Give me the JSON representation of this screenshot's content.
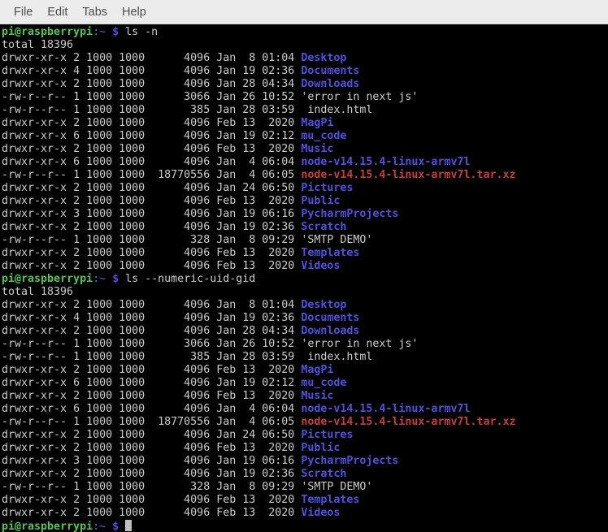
{
  "window": {
    "title": "pi@raspberrypi: ~",
    "background": "#000000",
    "foreground": "#cccccc"
  },
  "menubar": {
    "items": [
      {
        "label": "File",
        "name": "menu-file"
      },
      {
        "label": "Edit",
        "name": "menu-edit"
      },
      {
        "label": "Tabs",
        "name": "menu-tabs"
      },
      {
        "label": "Help",
        "name": "menu-help"
      }
    ]
  },
  "colors": {
    "prompt_user_host": "#4ec94e",
    "prompt_path": "#6565e0",
    "prompt_dollar": "#4e4ee8",
    "directory": "#5050e6",
    "archive": "#cc3b3b",
    "regular_file": "#cccccc",
    "menubar_bg": "#ececec",
    "terminal_bg": "#000000"
  },
  "prompt": {
    "user_host": "pi@raspberrypi",
    "path": ":~",
    "dollar": "$"
  },
  "session": {
    "blocks": [
      {
        "command": "ls -n",
        "total_line": "total 18396",
        "rows": [
          {
            "perms": "drwxr-xr-x",
            "links": "2",
            "uid": "1000",
            "gid": "1000",
            "size": "4096",
            "month": "Jan",
            "day": " 8",
            "time": "01:04",
            "name": "Desktop",
            "type": "dir"
          },
          {
            "perms": "drwxr-xr-x",
            "links": "4",
            "uid": "1000",
            "gid": "1000",
            "size": "4096",
            "month": "Jan",
            "day": "19",
            "time": "02:36",
            "name": "Documents",
            "type": "dir"
          },
          {
            "perms": "drwxr-xr-x",
            "links": "2",
            "uid": "1000",
            "gid": "1000",
            "size": "4096",
            "month": "Jan",
            "day": "28",
            "time": "04:34",
            "name": "Downloads",
            "type": "dir"
          },
          {
            "perms": "-rw-r--r--",
            "links": "1",
            "uid": "1000",
            "gid": "1000",
            "size": "3066",
            "month": "Jan",
            "day": "26",
            "time": "10:52",
            "name": "'error in next js'",
            "type": "file"
          },
          {
            "perms": "-rw-r--r--",
            "links": "1",
            "uid": "1000",
            "gid": "1000",
            "size": "385",
            "month": "Jan",
            "day": "28",
            "time": "03:59",
            "name": " index.html",
            "type": "file"
          },
          {
            "perms": "drwxr-xr-x",
            "links": "2",
            "uid": "1000",
            "gid": "1000",
            "size": "4096",
            "month": "Feb",
            "day": "13",
            "time": " 2020",
            "name": "MagPi",
            "type": "dir"
          },
          {
            "perms": "drwxr-xr-x",
            "links": "6",
            "uid": "1000",
            "gid": "1000",
            "size": "4096",
            "month": "Jan",
            "day": "19",
            "time": "02:12",
            "name": "mu_code",
            "type": "dir"
          },
          {
            "perms": "drwxr-xr-x",
            "links": "2",
            "uid": "1000",
            "gid": "1000",
            "size": "4096",
            "month": "Feb",
            "day": "13",
            "time": " 2020",
            "name": "Music",
            "type": "dir"
          },
          {
            "perms": "drwxr-xr-x",
            "links": "6",
            "uid": "1000",
            "gid": "1000",
            "size": "4096",
            "month": "Jan",
            "day": " 4",
            "time": "06:04",
            "name": "node-v14.15.4-linux-armv7l",
            "type": "dir"
          },
          {
            "perms": "-rw-r--r--",
            "links": "1",
            "uid": "1000",
            "gid": "1000",
            "size": "18770556",
            "month": "Jan",
            "day": " 4",
            "time": "06:05",
            "name": "node-v14.15.4-linux-armv7l.tar.xz",
            "type": "archive"
          },
          {
            "perms": "drwxr-xr-x",
            "links": "2",
            "uid": "1000",
            "gid": "1000",
            "size": "4096",
            "month": "Jan",
            "day": "24",
            "time": "06:50",
            "name": "Pictures",
            "type": "dir"
          },
          {
            "perms": "drwxr-xr-x",
            "links": "2",
            "uid": "1000",
            "gid": "1000",
            "size": "4096",
            "month": "Feb",
            "day": "13",
            "time": " 2020",
            "name": "Public",
            "type": "dir"
          },
          {
            "perms": "drwxr-xr-x",
            "links": "3",
            "uid": "1000",
            "gid": "1000",
            "size": "4096",
            "month": "Jan",
            "day": "19",
            "time": "06:16",
            "name": "PycharmProjects",
            "type": "dir"
          },
          {
            "perms": "drwxr-xr-x",
            "links": "2",
            "uid": "1000",
            "gid": "1000",
            "size": "4096",
            "month": "Jan",
            "day": "19",
            "time": "02:36",
            "name": "Scratch",
            "type": "dir"
          },
          {
            "perms": "-rw-r--r--",
            "links": "1",
            "uid": "1000",
            "gid": "1000",
            "size": "328",
            "month": "Jan",
            "day": " 8",
            "time": "09:29",
            "name": "'SMTP DEMO'",
            "type": "file"
          },
          {
            "perms": "drwxr-xr-x",
            "links": "2",
            "uid": "1000",
            "gid": "1000",
            "size": "4096",
            "month": "Feb",
            "day": "13",
            "time": " 2020",
            "name": "Templates",
            "type": "dir"
          },
          {
            "perms": "drwxr-xr-x",
            "links": "2",
            "uid": "1000",
            "gid": "1000",
            "size": "4096",
            "month": "Feb",
            "day": "13",
            "time": " 2020",
            "name": "Videos",
            "type": "dir"
          }
        ]
      },
      {
        "command": "ls --numeric-uid-gid",
        "total_line": "total 18396",
        "rows": [
          {
            "perms": "drwxr-xr-x",
            "links": "2",
            "uid": "1000",
            "gid": "1000",
            "size": "4096",
            "month": "Jan",
            "day": " 8",
            "time": "01:04",
            "name": "Desktop",
            "type": "dir"
          },
          {
            "perms": "drwxr-xr-x",
            "links": "4",
            "uid": "1000",
            "gid": "1000",
            "size": "4096",
            "month": "Jan",
            "day": "19",
            "time": "02:36",
            "name": "Documents",
            "type": "dir"
          },
          {
            "perms": "drwxr-xr-x",
            "links": "2",
            "uid": "1000",
            "gid": "1000",
            "size": "4096",
            "month": "Jan",
            "day": "28",
            "time": "04:34",
            "name": "Downloads",
            "type": "dir"
          },
          {
            "perms": "-rw-r--r--",
            "links": "1",
            "uid": "1000",
            "gid": "1000",
            "size": "3066",
            "month": "Jan",
            "day": "26",
            "time": "10:52",
            "name": "'error in next js'",
            "type": "file"
          },
          {
            "perms": "-rw-r--r--",
            "links": "1",
            "uid": "1000",
            "gid": "1000",
            "size": "385",
            "month": "Jan",
            "day": "28",
            "time": "03:59",
            "name": " index.html",
            "type": "file"
          },
          {
            "perms": "drwxr-xr-x",
            "links": "2",
            "uid": "1000",
            "gid": "1000",
            "size": "4096",
            "month": "Feb",
            "day": "13",
            "time": " 2020",
            "name": "MagPi",
            "type": "dir"
          },
          {
            "perms": "drwxr-xr-x",
            "links": "6",
            "uid": "1000",
            "gid": "1000",
            "size": "4096",
            "month": "Jan",
            "day": "19",
            "time": "02:12",
            "name": "mu_code",
            "type": "dir"
          },
          {
            "perms": "drwxr-xr-x",
            "links": "2",
            "uid": "1000",
            "gid": "1000",
            "size": "4096",
            "month": "Feb",
            "day": "13",
            "time": " 2020",
            "name": "Music",
            "type": "dir"
          },
          {
            "perms": "drwxr-xr-x",
            "links": "6",
            "uid": "1000",
            "gid": "1000",
            "size": "4096",
            "month": "Jan",
            "day": " 4",
            "time": "06:04",
            "name": "node-v14.15.4-linux-armv7l",
            "type": "dir"
          },
          {
            "perms": "-rw-r--r--",
            "links": "1",
            "uid": "1000",
            "gid": "1000",
            "size": "18770556",
            "month": "Jan",
            "day": " 4",
            "time": "06:05",
            "name": "node-v14.15.4-linux-armv7l.tar.xz",
            "type": "archive"
          },
          {
            "perms": "drwxr-xr-x",
            "links": "2",
            "uid": "1000",
            "gid": "1000",
            "size": "4096",
            "month": "Jan",
            "day": "24",
            "time": "06:50",
            "name": "Pictures",
            "type": "dir"
          },
          {
            "perms": "drwxr-xr-x",
            "links": "2",
            "uid": "1000",
            "gid": "1000",
            "size": "4096",
            "month": "Feb",
            "day": "13",
            "time": " 2020",
            "name": "Public",
            "type": "dir"
          },
          {
            "perms": "drwxr-xr-x",
            "links": "3",
            "uid": "1000",
            "gid": "1000",
            "size": "4096",
            "month": "Jan",
            "day": "19",
            "time": "06:16",
            "name": "PycharmProjects",
            "type": "dir"
          },
          {
            "perms": "drwxr-xr-x",
            "links": "2",
            "uid": "1000",
            "gid": "1000",
            "size": "4096",
            "month": "Jan",
            "day": "19",
            "time": "02:36",
            "name": "Scratch",
            "type": "dir"
          },
          {
            "perms": "-rw-r--r--",
            "links": "1",
            "uid": "1000",
            "gid": "1000",
            "size": "328",
            "month": "Jan",
            "day": " 8",
            "time": "09:29",
            "name": "'SMTP DEMO'",
            "type": "file"
          },
          {
            "perms": "drwxr-xr-x",
            "links": "2",
            "uid": "1000",
            "gid": "1000",
            "size": "4096",
            "month": "Feb",
            "day": "13",
            "time": " 2020",
            "name": "Templates",
            "type": "dir"
          },
          {
            "perms": "drwxr-xr-x",
            "links": "2",
            "uid": "1000",
            "gid": "1000",
            "size": "4096",
            "month": "Feb",
            "day": "13",
            "time": " 2020",
            "name": "Videos",
            "type": "dir"
          }
        ]
      }
    ],
    "final_prompt_input": ""
  }
}
